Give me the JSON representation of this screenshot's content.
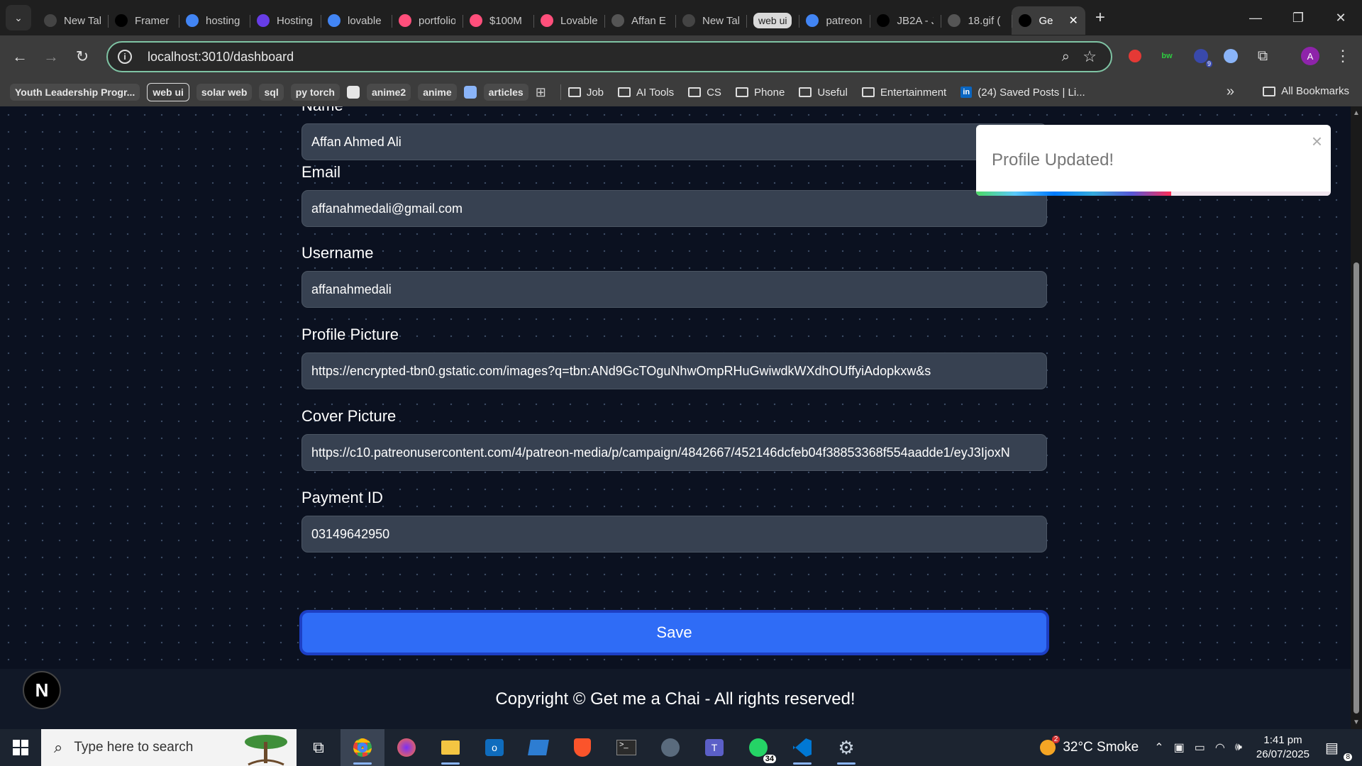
{
  "browser": {
    "tabs": [
      {
        "label": "New Tab",
        "favicon": "chrome-icon",
        "color": "#444"
      },
      {
        "label": "Framer",
        "favicon": "framer-icon",
        "color": "#000"
      },
      {
        "label": "hosting",
        "favicon": "google-icon",
        "color": "#4285f4"
      },
      {
        "label": "Hosting",
        "favicon": "hostinger-icon",
        "color": "#673de6"
      },
      {
        "label": "lovable",
        "favicon": "google-icon",
        "color": "#4285f4"
      },
      {
        "label": "portfolio",
        "favicon": "lovable-icon",
        "color": "#ff4f7b"
      },
      {
        "label": "$100M",
        "favicon": "lovable-icon",
        "color": "#ff4f7b"
      },
      {
        "label": "Lovable",
        "favicon": "lovable-icon",
        "color": "#ff4f7b"
      },
      {
        "label": "Affan E",
        "favicon": "globe-icon",
        "color": "#555"
      },
      {
        "label": "New Tab",
        "favicon": "chrome-icon",
        "color": "#444"
      },
      {
        "label": "web ui",
        "favicon": "",
        "color": "",
        "pill": true
      },
      {
        "label": "patreon",
        "favicon": "google-icon",
        "color": "#4285f4"
      },
      {
        "label": "JB2A - J",
        "favicon": "patreon-icon",
        "color": "#000"
      },
      {
        "label": "18.gif (",
        "favicon": "globe-icon",
        "color": "#555"
      },
      {
        "label": "Ge",
        "favicon": "vercel-icon",
        "color": "#000",
        "active": true
      }
    ],
    "new_tab_label": "+",
    "url": "localhost:3010/dashboard",
    "profile_initial": "A",
    "bookmarks": [
      {
        "label": "Youth Leadership Progr...",
        "kind": "chip"
      },
      {
        "label": "web ui",
        "kind": "outline"
      },
      {
        "label": "solar web",
        "kind": "chip"
      },
      {
        "label": "sql",
        "kind": "chip"
      },
      {
        "label": "py torch",
        "kind": "chip"
      },
      {
        "label": "",
        "kind": "square"
      },
      {
        "label": "anime2",
        "kind": "chip"
      },
      {
        "label": "anime",
        "kind": "chip"
      },
      {
        "label": "",
        "kind": "square-blue"
      },
      {
        "label": "articles",
        "kind": "chip"
      }
    ],
    "folders": [
      "Job",
      "AI Tools",
      "CS",
      "Phone",
      "Useful",
      "Entertainment"
    ],
    "linkedin_bookmark": "(24) Saved Posts | Li...",
    "all_bookmarks": "All Bookmarks"
  },
  "form": {
    "name_label": "Name",
    "name_value": "Affan Ahmed Ali",
    "email_label": "Email",
    "email_value": "affanahmedali@gmail.com",
    "username_label": "Username",
    "username_value": "affanahmedali",
    "profile_picture_label": "Profile Picture",
    "profile_picture_value": "https://encrypted-tbn0.gstatic.com/images?q=tbn:ANd9GcTOguNhwOmpRHuGwiwdkWXdhOUffyiAdopkxw&s",
    "cover_picture_label": "Cover Picture",
    "cover_picture_value": "https://c10.patreonusercontent.com/4/patreon-media/p/campaign/4842667/452146dcfeb04f38853368f554aadde1/eyJ3IjoxN",
    "payment_id_label": "Payment ID",
    "payment_id_value": "03149642950",
    "save_label": "Save"
  },
  "toast": {
    "message": "Profile Updated!",
    "close": "×",
    "progress": 0.55
  },
  "footer": {
    "copyright": "Copyright © Get me a Chai - All rights reserved!",
    "badge": "N"
  },
  "taskbar": {
    "search_placeholder": "Type here to search",
    "whatsapp_count": "34",
    "weather": "32°C  Smoke",
    "weather_alert": "2",
    "time": "1:41 pm",
    "date": "26/07/2025",
    "notifications": "8"
  },
  "colors": {
    "page_bg": "#0b1120",
    "input_bg": "#374151",
    "save_button": "#2f6cf6",
    "footer_bg": "#111827"
  }
}
